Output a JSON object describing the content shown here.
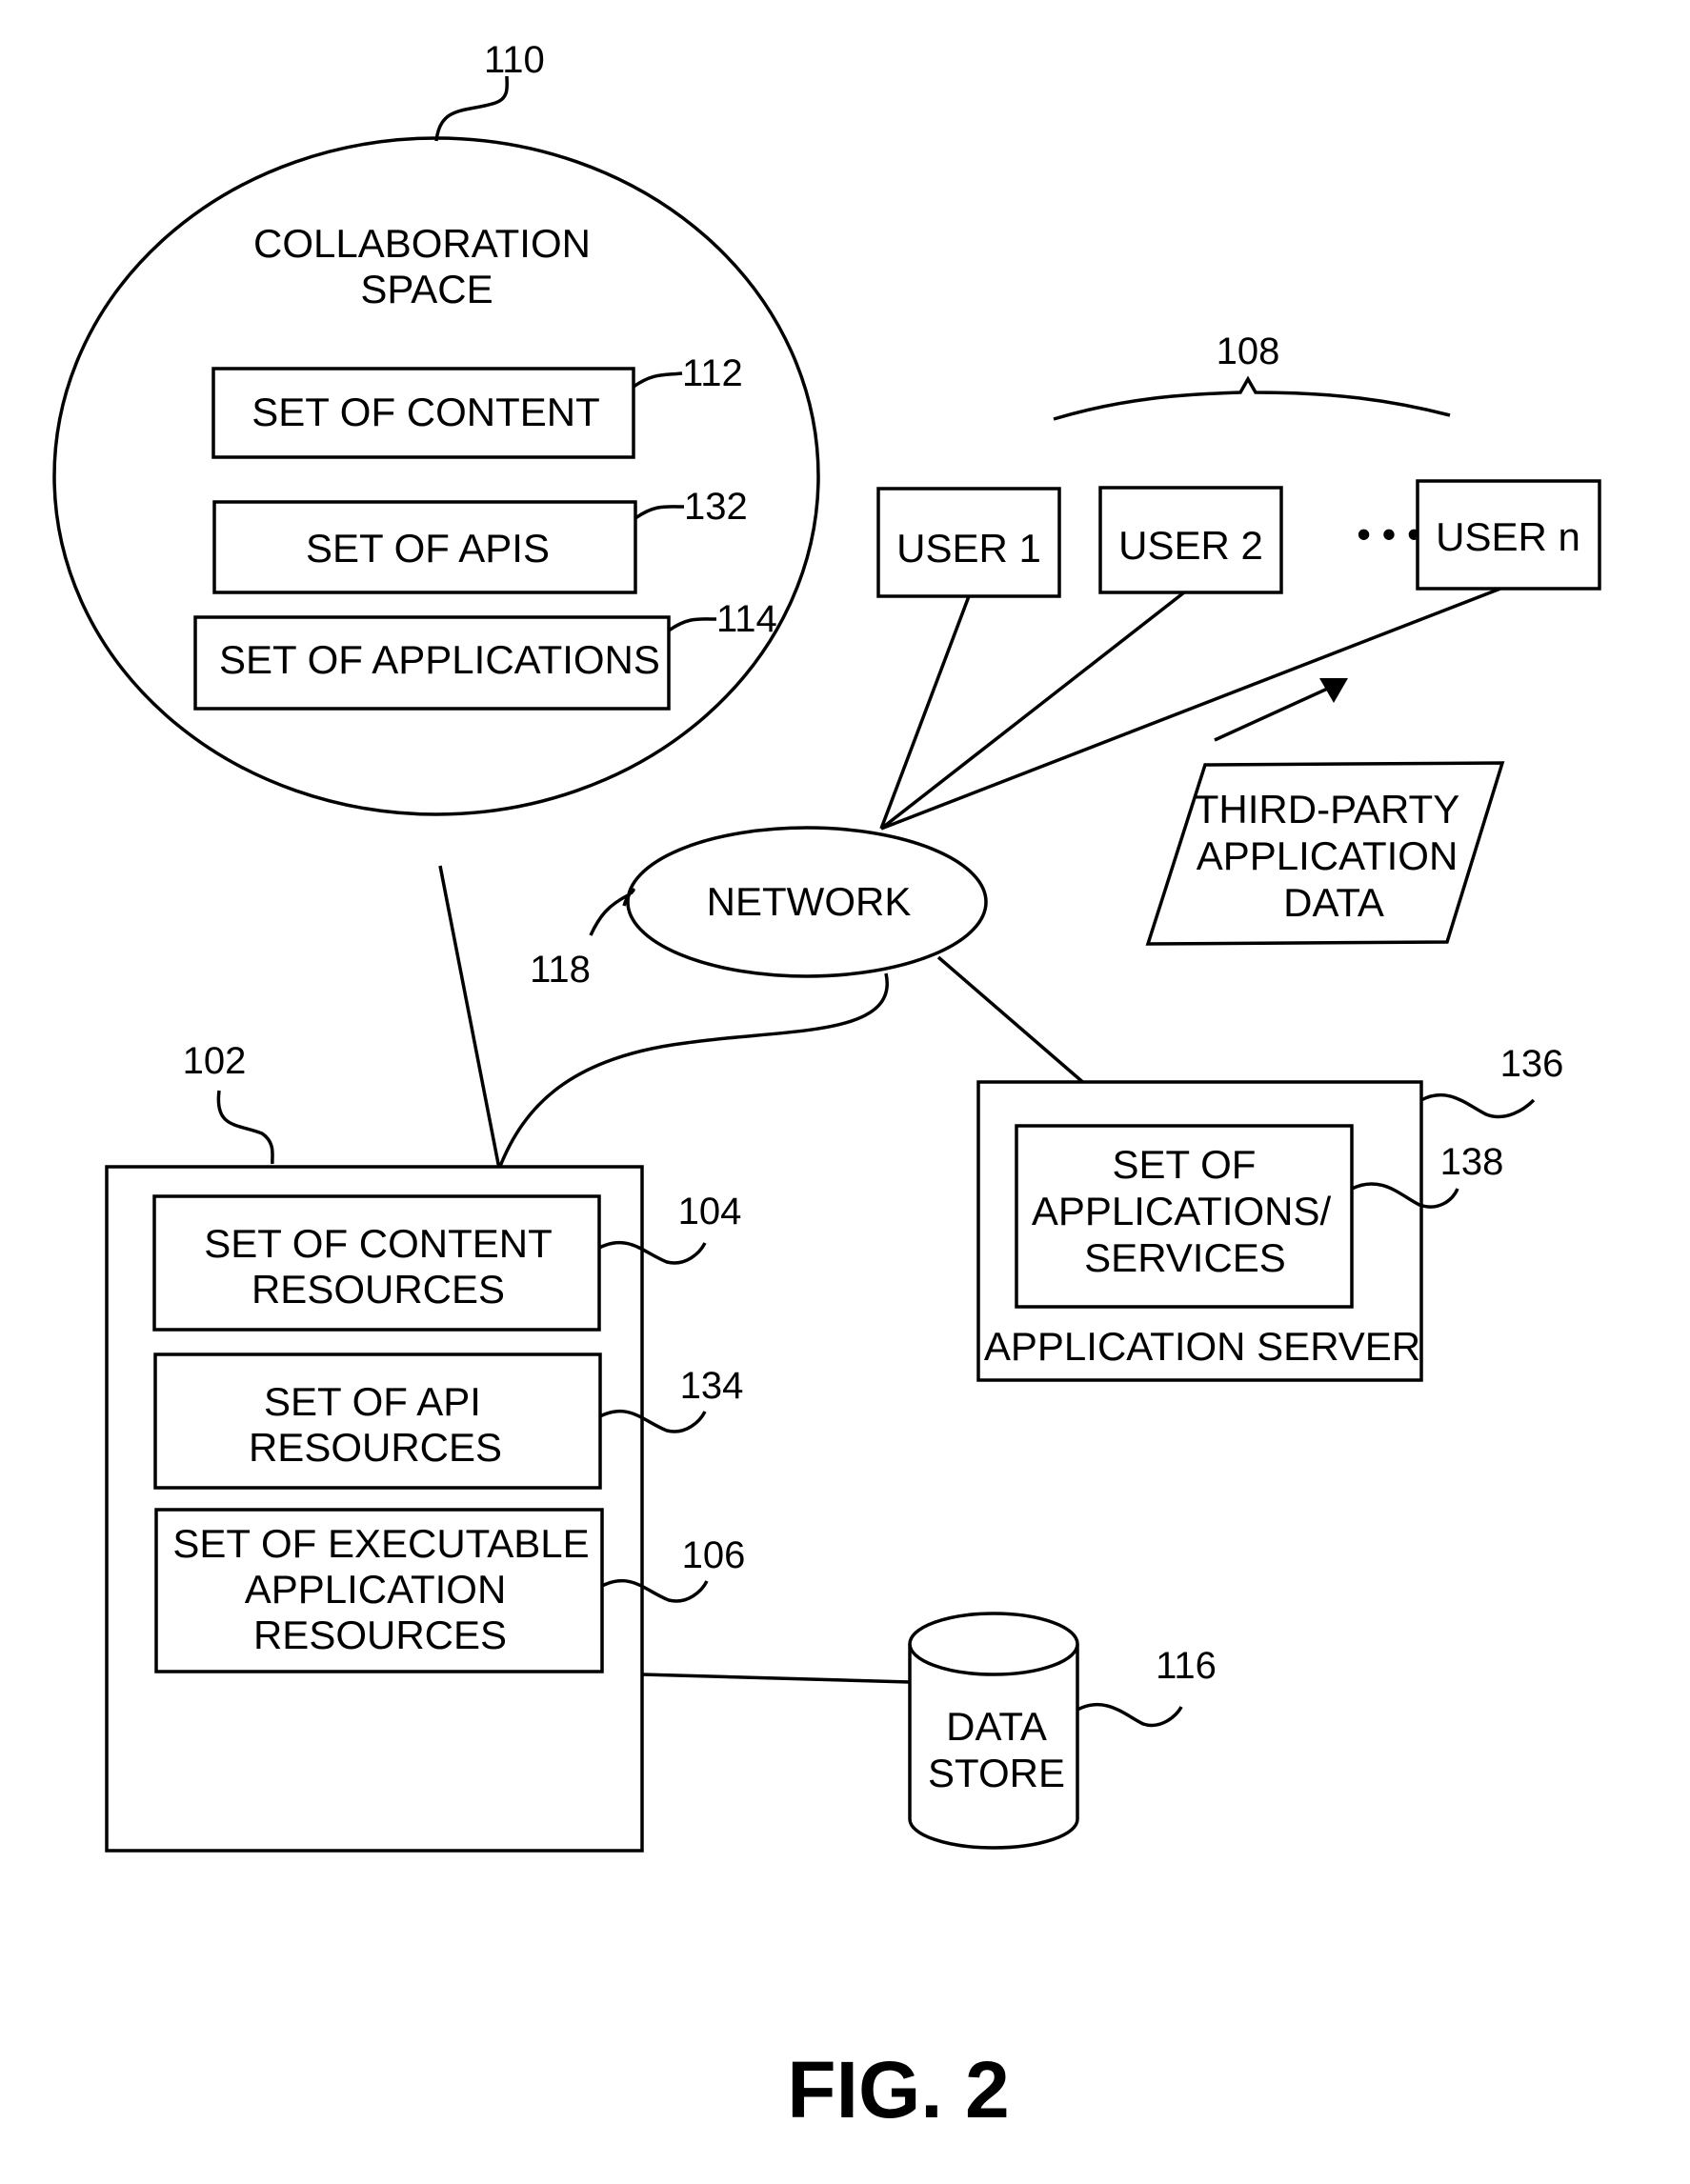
{
  "figure": {
    "label": "FIG. 2"
  },
  "collaboration_space": {
    "ref": "110",
    "title_lines": [
      "COLLABORATION",
      "SPACE"
    ],
    "items": [
      {
        "ref": "112",
        "label": "SET OF CONTENT"
      },
      {
        "ref": "132",
        "label": "SET OF APIS"
      },
      {
        "ref": "114",
        "label": "SET OF APPLICATIONS"
      }
    ]
  },
  "users": {
    "ref": "108",
    "items": [
      "USER 1",
      "USER 2",
      "USER n"
    ],
    "ellipsis": "• • •"
  },
  "network": {
    "ref": "118",
    "label": "NETWORK"
  },
  "third_party": {
    "lines": [
      "THIRD-PARTY",
      "APPLICATION",
      "DATA"
    ]
  },
  "server": {
    "ref": "102",
    "items": [
      {
        "ref": "104",
        "lines": [
          "SET OF CONTENT",
          "RESOURCES"
        ]
      },
      {
        "ref": "134",
        "lines": [
          "SET OF API",
          "RESOURCES"
        ]
      },
      {
        "ref": "106",
        "lines": [
          "SET OF EXECUTABLE",
          "APPLICATION",
          "RESOURCES"
        ]
      }
    ]
  },
  "application_server": {
    "ref": "136",
    "label": "APPLICATION SERVER",
    "inner": {
      "ref": "138",
      "lines": [
        "SET OF",
        "APPLICATIONS/",
        "SERVICES"
      ]
    }
  },
  "data_store": {
    "ref": "116",
    "lines": [
      "DATA",
      "STORE"
    ]
  }
}
